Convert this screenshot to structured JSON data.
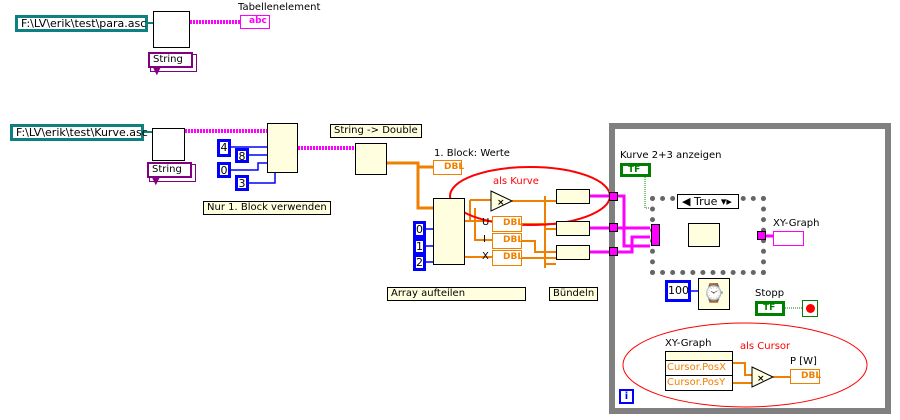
{
  "top": {
    "path": "F:\\LV\\erik\\test\\para.asc",
    "type": "String",
    "indicator_label": "Tabellenelement",
    "indicator": "abc"
  },
  "curve": {
    "path": "F:\\LV\\erik\\test\\Kurve.asc",
    "type": "String",
    "constants": [
      "4",
      "8",
      "0",
      "3"
    ],
    "comment": "Nur 1. Block verwenden",
    "conv_comment": "String -> Double"
  },
  "block": {
    "label": "1. Block: Werte",
    "dbl": "DBL",
    "index_consts": [
      "0",
      "1",
      "2"
    ],
    "split_comment": "Array aufteilen",
    "bundle_comment": "Bündeln",
    "annotation": "als Kurve",
    "u": "U",
    "i": "I",
    "x": "X"
  },
  "loop": {
    "toggle_label": "Kurve 2+3 anzeigen",
    "tf": "TF",
    "case_value": "True",
    "graph_label": "XY-Graph",
    "wait_ms": "100",
    "stop_label": "Stopp",
    "iteration": "i"
  },
  "cursor": {
    "annotation": "als Cursor",
    "node_label": "XY-Graph",
    "posx": "Cursor.PosX",
    "posy": "Cursor.PosY",
    "out_label": "P [W]",
    "dbl": "DBL"
  },
  "colors": {
    "path": "#0f7f7f",
    "string": "#ff00ff",
    "double": "#f08000",
    "int": "#0000ff",
    "bool": "#008000",
    "annotation": "#ff0000"
  }
}
